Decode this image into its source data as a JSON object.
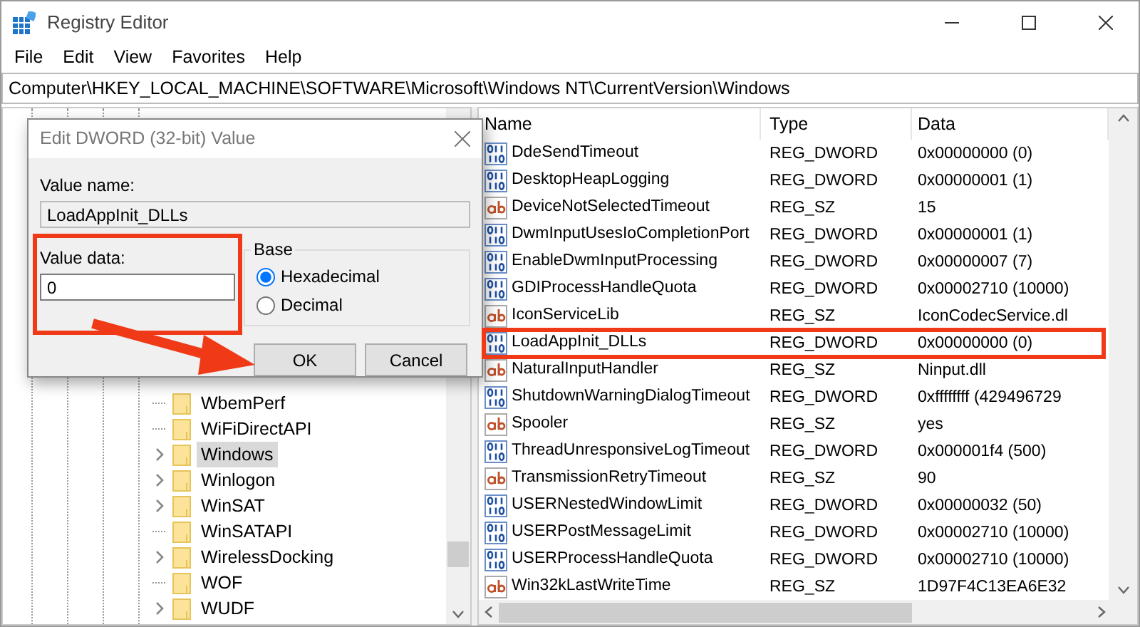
{
  "window": {
    "title": "Registry Editor"
  },
  "menu": [
    "File",
    "Edit",
    "View",
    "Favorites",
    "Help"
  ],
  "address": "Computer\\HKEY_LOCAL_MACHINE\\SOFTWARE\\Microsoft\\Windows NT\\CurrentVersion\\Windows",
  "tree": {
    "items": [
      {
        "label": "WbemPerf",
        "expandable": false,
        "selected": false
      },
      {
        "label": "WiFiDirectAPI",
        "expandable": false,
        "selected": false
      },
      {
        "label": "Windows",
        "expandable": true,
        "selected": true
      },
      {
        "label": "Winlogon",
        "expandable": true,
        "selected": false
      },
      {
        "label": "WinSAT",
        "expandable": true,
        "selected": false
      },
      {
        "label": "WinSATAPI",
        "expandable": false,
        "selected": false
      },
      {
        "label": "WirelessDocking",
        "expandable": true,
        "selected": false
      },
      {
        "label": "WOF",
        "expandable": false,
        "selected": false
      },
      {
        "label": "WUDF",
        "expandable": true,
        "selected": false
      }
    ]
  },
  "list": {
    "columns": [
      "Name",
      "Type",
      "Data"
    ],
    "rows": [
      {
        "kind": "dword",
        "name": "DdeSendTimeout",
        "type": "REG_DWORD",
        "data": "0x00000000 (0)",
        "annotated": false
      },
      {
        "kind": "dword",
        "name": "DesktopHeapLogging",
        "type": "REG_DWORD",
        "data": "0x00000001 (1)",
        "annotated": false
      },
      {
        "kind": "sz",
        "name": "DeviceNotSelectedTimeout",
        "type": "REG_SZ",
        "data": "15",
        "annotated": false
      },
      {
        "kind": "dword",
        "name": "DwmInputUsesIoCompletionPort",
        "type": "REG_DWORD",
        "data": "0x00000001 (1)",
        "annotated": false
      },
      {
        "kind": "dword",
        "name": "EnableDwmInputProcessing",
        "type": "REG_DWORD",
        "data": "0x00000007 (7)",
        "annotated": false
      },
      {
        "kind": "dword",
        "name": "GDIProcessHandleQuota",
        "type": "REG_DWORD",
        "data": "0x00002710 (10000)",
        "annotated": false
      },
      {
        "kind": "sz",
        "name": "IconServiceLib",
        "type": "REG_SZ",
        "data": "IconCodecService.dl",
        "annotated": false
      },
      {
        "kind": "dword",
        "name": "LoadAppInit_DLLs",
        "type": "REG_DWORD",
        "data": "0x00000000 (0)",
        "annotated": true
      },
      {
        "kind": "sz",
        "name": "NaturalInputHandler",
        "type": "REG_SZ",
        "data": "Ninput.dll",
        "annotated": false
      },
      {
        "kind": "dword",
        "name": "ShutdownWarningDialogTimeout",
        "type": "REG_DWORD",
        "data": "0xffffffff (429496729",
        "annotated": false
      },
      {
        "kind": "sz",
        "name": "Spooler",
        "type": "REG_SZ",
        "data": "yes",
        "annotated": false
      },
      {
        "kind": "dword",
        "name": "ThreadUnresponsiveLogTimeout",
        "type": "REG_DWORD",
        "data": "0x000001f4 (500)",
        "annotated": false
      },
      {
        "kind": "sz",
        "name": "TransmissionRetryTimeout",
        "type": "REG_SZ",
        "data": "90",
        "annotated": false
      },
      {
        "kind": "dword",
        "name": "USERNestedWindowLimit",
        "type": "REG_DWORD",
        "data": "0x00000032 (50)",
        "annotated": false
      },
      {
        "kind": "dword",
        "name": "USERPostMessageLimit",
        "type": "REG_DWORD",
        "data": "0x00002710 (10000)",
        "annotated": false
      },
      {
        "kind": "dword",
        "name": "USERProcessHandleQuota",
        "type": "REG_DWORD",
        "data": "0x00002710 (10000)",
        "annotated": false
      },
      {
        "kind": "sz",
        "name": "Win32kLastWriteTime",
        "type": "REG_SZ",
        "data": "1D97F4C13EA6E32",
        "annotated": false
      }
    ]
  },
  "dialog": {
    "title": "Edit DWORD (32-bit) Value",
    "value_name_label": "Value name:",
    "value_name": "LoadAppInit_DLLs",
    "value_data_label": "Value data:",
    "value_data": "0",
    "value_data_annotated": true,
    "base_label": "Base",
    "bases": [
      {
        "label": "Hexadecimal",
        "selected": true
      },
      {
        "label": "Decimal",
        "selected": false
      }
    ],
    "buttons": [
      "OK",
      "Cancel"
    ]
  }
}
